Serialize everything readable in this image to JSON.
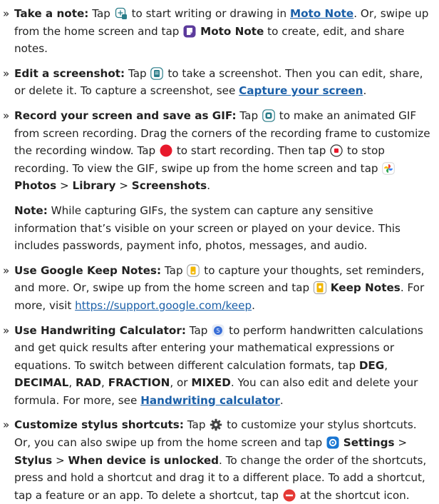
{
  "colors": {
    "text": "#222222",
    "link": "#1a5fa8",
    "record_red": "#e8192c",
    "minus_red": "#e53935",
    "icon_teal": "#2c7e8a",
    "icon_gold": "#f2b705",
    "icon_blue": "#3a6fd8",
    "moto_note_purple": "#5c3b9c",
    "settings_blue": "#1976d2"
  },
  "items": [
    {
      "marker": "»",
      "title": "Take a note:",
      "t1": "Tap",
      "icon1": "plus-note-icon",
      "t2": "to start writing or drawing in",
      "link1": "Moto Note",
      "t3": ". Or, swipe up from the home screen and tap",
      "icon2": "moto-note-icon",
      "bold1": "Moto Note",
      "t4": "to create, edit, and share notes."
    },
    {
      "marker": "»",
      "title": "Edit a screenshot:",
      "t1": "Tap",
      "icon1": "screenshot-icon",
      "t2": "to take a screenshot. Then you can edit, share, or delete it. To capture a screenshot, see",
      "link1": "Capture your screen",
      "t3": "."
    },
    {
      "marker": "»",
      "title": "Record your screen and save as GIF:",
      "t1": "Tap",
      "icon1": "gif-record-icon",
      "t2": "to make an animated GIF from screen recording. Drag the corners of the recording frame to customize the recording window. Tap",
      "icon2": "record-button-icon",
      "t3": "to start recording. Then tap",
      "icon3": "stop-button-icon",
      "t4": "to stop recording. To view the GIF, swipe up from the home screen and tap",
      "icon4": "photos-icon",
      "bold1": "Photos",
      "sep1": ">",
      "bold2": "Library",
      "sep2": ">",
      "bold3": "Screenshots",
      "t5": "."
    },
    {
      "marker": "»",
      "title": "Use Google Keep Notes:",
      "t1": "Tap",
      "icon1": "keep-notes-icon",
      "t2": "to capture your thoughts, set reminders, and more. Or, swipe up from the home screen and tap",
      "icon2": "keep-notes-app-icon",
      "bold1": "Keep Notes",
      "t3": ". For more, visit",
      "url": "https://support.google.com/keep",
      "t4": "."
    },
    {
      "marker": "»",
      "title": "Use Handwriting Calculator:",
      "t1": "Tap",
      "icon1": "calculator-icon",
      "t2": "to perform handwritten calculations and get quick results after entering your mathematical expressions or equations. To switch between different calculation formats, tap",
      "bold1": "DEG",
      "c1": ",",
      "bold2": "DECIMAL",
      "c2": ",",
      "bold3": "RAD",
      "c3": ",",
      "bold4": "FRACTION",
      "c4": ", or",
      "bold5": "MIXED",
      "t3": ". You can also edit and delete your formula. For more, see",
      "link1": "Handwriting calculator",
      "t4": "."
    },
    {
      "marker": "»",
      "title": "Customize stylus shortcuts:",
      "t1": "Tap",
      "icon1": "gear-icon",
      "t2": "to customize your stylus shortcuts. Or, you can also swipe up from the home screen and tap",
      "icon2": "settings-icon",
      "bold1": "Settings",
      "sep1": ">",
      "bold2": "Stylus",
      "sep2": ">",
      "bold3": "When device is unlocked",
      "t3": ". To change the order of the shortcuts, press and hold a shortcut and drag it to a different place. To add a shortcut, tap a feature or an app. To delete a shortcut, tap",
      "icon3": "minus-circle-icon",
      "t4": "at the shortcut icon."
    }
  ],
  "note": {
    "title": "Note:",
    "text": "While capturing GIFs, the system can capture any sensitive information that’s visible on your screen or played on your device. This includes passwords, payment info, photos, messages, and audio."
  }
}
